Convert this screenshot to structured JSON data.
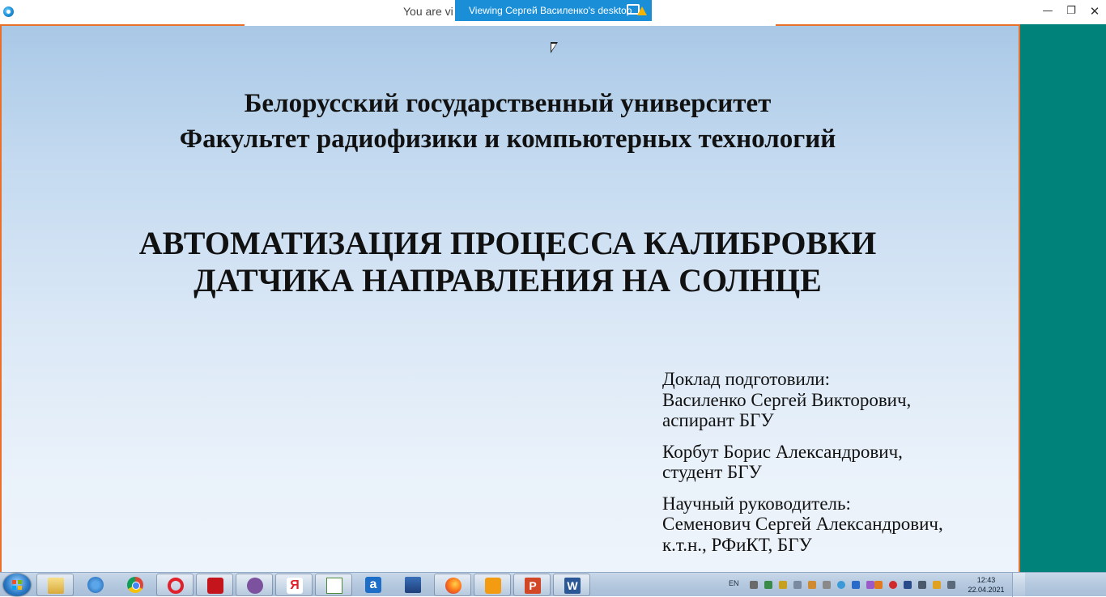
{
  "window": {
    "title_partial": "You are vi",
    "viewing_banner": "Viewing Сергей Василенко's desktop",
    "minimize": "—",
    "maximize": "❐",
    "close": "✕"
  },
  "slide": {
    "university_line1": "Белорусский государственный университет",
    "university_line2": "Факультет радиофизики и компьютерных технологий",
    "topic_line1": "АВТОМАТИЗАЦИЯ ПРОЦЕССА КАЛИБРОВКИ",
    "topic_line2": "ДАТЧИКА НАПРАВЛЕНИЯ НА СОЛНЦЕ",
    "authors": {
      "prepared_by": "Доклад подготовили:",
      "author1_name": "Василенко Сергей Викторович,",
      "author1_role": "аспирант БГУ",
      "author2_name": "Корбут Борис Александрович,",
      "author2_role": "студент БГУ",
      "supervisor_label": "Научный руководитель:",
      "supervisor_name": "Семенович Сергей Александрович,",
      "supervisor_role": "к.т.н., РФиКТ, БГУ"
    }
  },
  "taskbar": {
    "pinned": [
      {
        "name": "explorer-icon"
      },
      {
        "name": "outlook-icon"
      },
      {
        "name": "chrome-icon"
      },
      {
        "name": "opera-icon"
      },
      {
        "name": "acrobat-icon"
      },
      {
        "name": "viber-icon"
      },
      {
        "name": "yandex-browser-icon",
        "glyph": "Я"
      },
      {
        "name": "chart-app-icon"
      },
      {
        "name": "a-app-icon",
        "glyph": "a"
      },
      {
        "name": "network-app-icon"
      },
      {
        "name": "firefox-icon"
      },
      {
        "name": "pdf-app-icon"
      },
      {
        "name": "powerpoint-icon",
        "glyph": "P"
      },
      {
        "name": "word-icon",
        "glyph": "W"
      }
    ],
    "language": "EN",
    "time": "12:43",
    "date": "22.04.2021"
  },
  "colors": {
    "accent_frame": "#e8702a",
    "banner": "#1a8fd8",
    "right_panel": "#00827a"
  }
}
